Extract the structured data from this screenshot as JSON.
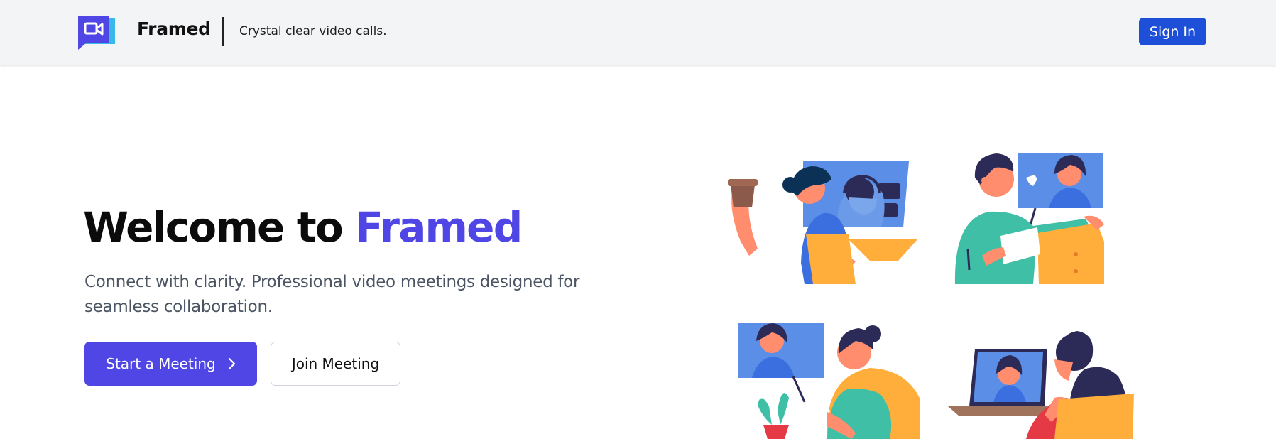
{
  "header": {
    "brand": "Framed",
    "tagline": "Crystal clear video calls.",
    "sign_in_label": "Sign In",
    "logo_icon": "video-camera-icon"
  },
  "hero": {
    "title_prefix": "Welcome to ",
    "title_accent": "Framed",
    "subtitle": "Connect with clarity. Professional video meetings designed for seamless collaboration.",
    "start_label": "Start a Meeting",
    "join_label": "Join Meeting",
    "start_icon": "chevron-right-icon"
  },
  "illustration": {
    "name": "video-call-people-illustration"
  },
  "colors": {
    "accent": "#4f46e5",
    "sign_in_bg": "#1d4fd8",
    "topbar_bg": "#f3f4f6",
    "subtitle_text": "#4b5563",
    "illus_blue": "#5b8ee6",
    "illus_orange": "#ffad3b",
    "illus_teal": "#3fbfa6",
    "illus_navy": "#2c2a57"
  }
}
